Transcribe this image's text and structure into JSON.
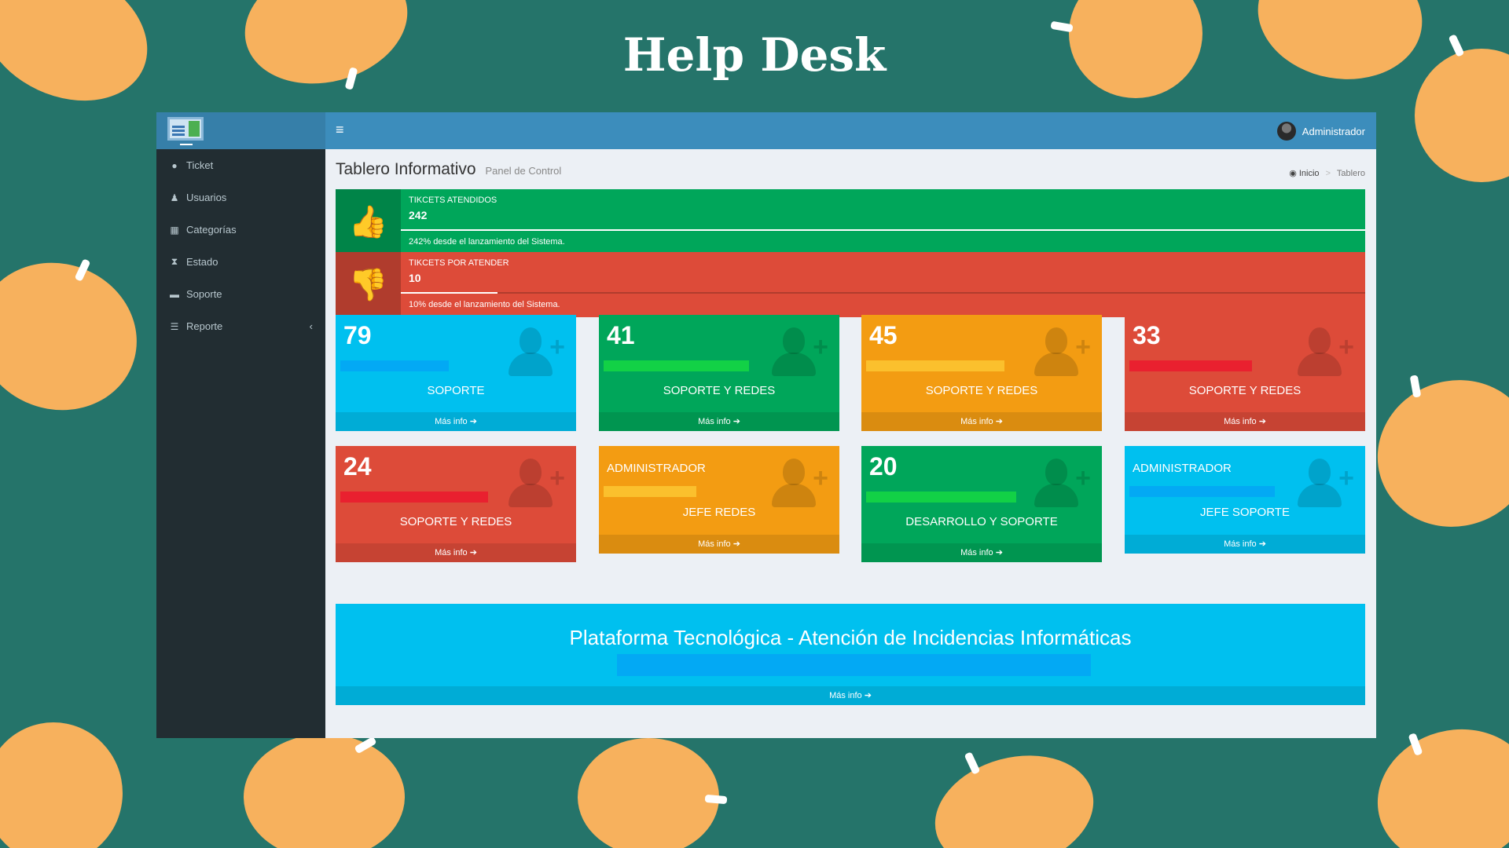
{
  "page_title": "Help Desk",
  "colors": {
    "aqua": "#00c0ef",
    "green": "#00a65a",
    "yellow": "#f39c12",
    "red": "#dd4b39",
    "topbar": "#3c8dbc",
    "sidebar": "#222d32",
    "background": "#25746a",
    "decor": "#f7b15d"
  },
  "sidebar": {
    "items": [
      {
        "label": "Ticket",
        "icon": "ticket-icon",
        "glyph": "●"
      },
      {
        "label": "Usuarios",
        "icon": "user-icon",
        "glyph": "♟"
      },
      {
        "label": "Categorías",
        "icon": "grid-icon",
        "glyph": "▦"
      },
      {
        "label": "Estado",
        "icon": "hourglass-icon",
        "glyph": "⧗"
      },
      {
        "label": "Soporte",
        "icon": "bed-icon",
        "glyph": "▬"
      },
      {
        "label": "Reporte",
        "icon": "list-icon",
        "glyph": "☰"
      }
    ],
    "reporte_chevron": "‹"
  },
  "topbar": {
    "menu_glyph": "≡",
    "user_name": "Administrador"
  },
  "header": {
    "title": "Tablero Informativo",
    "subtitle": "Panel de Control",
    "breadcrumb": [
      "Inicio",
      "Tablero"
    ],
    "breadcrumb_sep": ">"
  },
  "info_boxes": [
    {
      "label": "TIKCETS ATENDIDOS",
      "number": "242",
      "progress": 100,
      "description": "242% desde el lanzamiento del Sistema.",
      "color": "#00a65a",
      "icon": "thumbs-up-icon",
      "glyph": "👍"
    },
    {
      "label": "TIKCETS POR ATENDER",
      "number": "10",
      "progress": 10,
      "description": "10% desde el lanzamiento del Sistema.",
      "color": "#dd4b39",
      "icon": "thumbs-down-icon",
      "glyph": "👎"
    }
  ],
  "small_boxes": [
    {
      "number": "79",
      "label": "",
      "title": "SOPORTE",
      "color": "#00c0ef",
      "bar_color": "#03a9f4",
      "bar_fill": 0.47,
      "footer": "Más info ➔"
    },
    {
      "number": "41",
      "label": "",
      "title": "SOPORTE Y REDES",
      "color": "#00a65a",
      "bar_color": "#12d146",
      "bar_fill": 0.63,
      "footer": "Más info ➔"
    },
    {
      "number": "45",
      "label": "",
      "title": "SOPORTE Y REDES",
      "color": "#f39c12",
      "bar_color": "#fbc02d",
      "bar_fill": 0.6,
      "footer": "Más info ➔"
    },
    {
      "number": "33",
      "label": "",
      "title": "SOPORTE Y REDES",
      "color": "#dd4b39",
      "bar_color": "#e9202f",
      "bar_fill": 0.53,
      "footer": "Más info ➔"
    },
    {
      "number": "24",
      "label": "",
      "title": "SOPORTE Y REDES",
      "color": "#dd4b39",
      "bar_color": "#e9202f",
      "bar_fill": 0.64,
      "footer": "Más info ➔"
    },
    {
      "number": "",
      "label": "ADMINISTRADOR",
      "title": "JEFE REDES",
      "color": "#f39c12",
      "bar_color": "#fbc02d",
      "bar_fill": 0.4,
      "footer": "Más info ➔"
    },
    {
      "number": "20",
      "label": "",
      "title": "DESARROLLO Y SOPORTE",
      "color": "#00a65a",
      "bar_color": "#12d146",
      "bar_fill": 0.65,
      "footer": "Más info ➔"
    },
    {
      "number": "",
      "label": "ADMINISTRADOR",
      "title": "JEFE SOPORTE",
      "color": "#00c0ef",
      "bar_color": "#03a9f4",
      "bar_fill": 0.63,
      "footer": "Más info ➔"
    }
  ],
  "banner": {
    "title": "Plataforma Tecnológica - Atención de Incidencias Informáticas",
    "footer": "Más info ➔"
  }
}
